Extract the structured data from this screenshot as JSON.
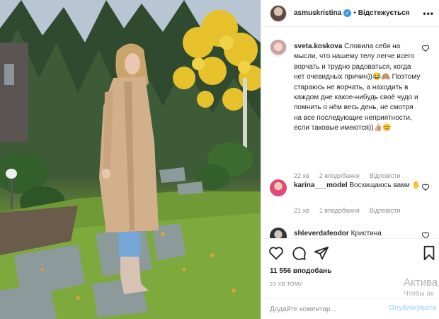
{
  "post": {
    "author": "asmuskristina",
    "separator": "•",
    "follow_status": "Відстежується",
    "more_icon": "more-options-icon"
  },
  "comments": [
    {
      "username": "sveta.koskova",
      "text": "Словила себя на мысли, что нашему телу легче всего ворчать и трудно радоваться, когда нет очевидных причин))😂🙈 Поэтому стараюсь не ворчать, а находить в каждом дне какое-нибудь своё чудо и помнить о нём весь день, не смотря на все последующие неприятности, если таковые имеются))👍🏼😊",
      "time": "22 хв",
      "likes": "2 вподобання",
      "reply": "Відповісти"
    },
    {
      "username": "karina___model",
      "text": "Восхищаюсь вами ✋",
      "time": "21 хв",
      "likes": "1 вподобання",
      "reply": "Відповісти"
    },
    {
      "username": "shleverdafeodor",
      "text": "Кристина"
    }
  ],
  "actions": {
    "like_icon": "heart-icon",
    "comment_icon": "comment-icon",
    "share_icon": "share-icon",
    "save_icon": "bookmark-icon"
  },
  "likes_count": "11 556 вподобань",
  "time_ago": "23 хв тому",
  "add_comment": {
    "placeholder": "Додайте коментар...",
    "publish_label": "Опублікувати"
  },
  "watermark": {
    "line1": "Актива",
    "line2": "Чтобы ак"
  },
  "colors": {
    "link_blue": "#3897f0",
    "publish_disabled": "#b3dbff",
    "meta_gray": "#8e8e8e"
  }
}
